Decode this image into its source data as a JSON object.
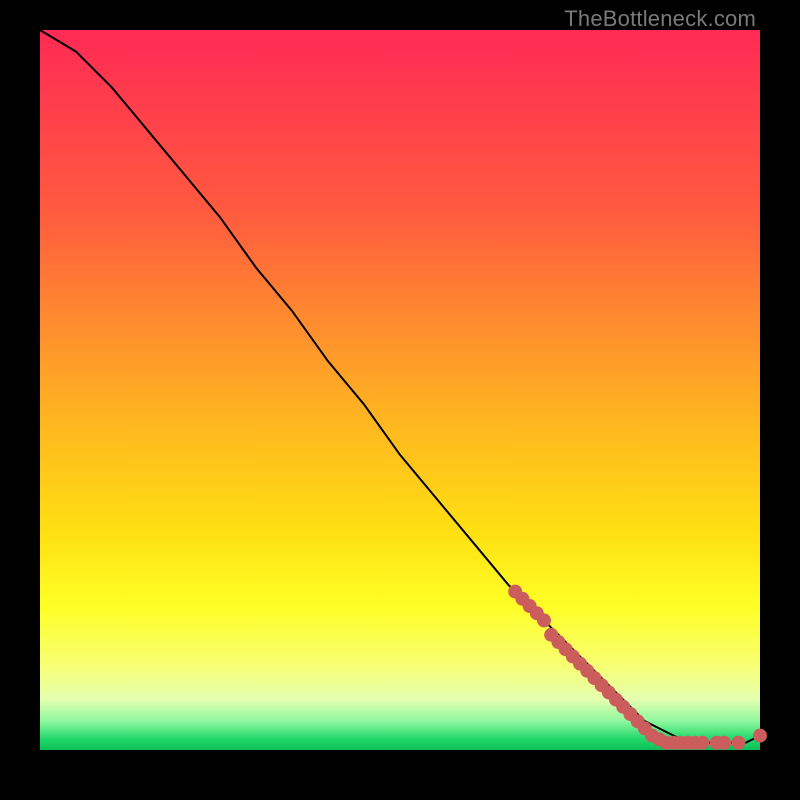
{
  "watermark": "TheBottleneck.com",
  "colors": {
    "marker": "#cc5d5d",
    "curve": "#000000"
  },
  "chart_data": {
    "type": "line",
    "title": "",
    "xlabel": "",
    "ylabel": "",
    "xlim": [
      0,
      100
    ],
    "ylim": [
      0,
      100
    ],
    "series": [
      {
        "name": "bottleneck-curve",
        "x": [
          0,
          5,
          10,
          15,
          20,
          25,
          30,
          35,
          40,
          45,
          50,
          55,
          60,
          65,
          70,
          75,
          80,
          82,
          84,
          86,
          88,
          90,
          92,
          94,
          96,
          98,
          100
        ],
        "y": [
          100,
          97,
          92,
          86,
          80,
          74,
          67,
          61,
          54,
          48,
          41,
          35,
          29,
          23,
          18,
          13,
          8,
          6,
          4,
          3,
          2,
          1,
          1,
          1,
          1,
          1,
          2
        ]
      }
    ],
    "markers": [
      {
        "x": 66,
        "y": 22
      },
      {
        "x": 67,
        "y": 21
      },
      {
        "x": 68,
        "y": 20
      },
      {
        "x": 69,
        "y": 19
      },
      {
        "x": 70,
        "y": 18
      },
      {
        "x": 71,
        "y": 16
      },
      {
        "x": 72,
        "y": 15
      },
      {
        "x": 73,
        "y": 14
      },
      {
        "x": 74,
        "y": 13
      },
      {
        "x": 75,
        "y": 12
      },
      {
        "x": 76,
        "y": 11
      },
      {
        "x": 77,
        "y": 10
      },
      {
        "x": 78,
        "y": 9
      },
      {
        "x": 79,
        "y": 8
      },
      {
        "x": 80,
        "y": 7
      },
      {
        "x": 81,
        "y": 6
      },
      {
        "x": 82,
        "y": 5
      },
      {
        "x": 83,
        "y": 4
      },
      {
        "x": 84,
        "y": 3
      },
      {
        "x": 85,
        "y": 2
      },
      {
        "x": 86,
        "y": 1.5
      },
      {
        "x": 87,
        "y": 1
      },
      {
        "x": 88,
        "y": 1
      },
      {
        "x": 89,
        "y": 1
      },
      {
        "x": 90,
        "y": 1
      },
      {
        "x": 91,
        "y": 1
      },
      {
        "x": 92,
        "y": 1
      },
      {
        "x": 94,
        "y": 1
      },
      {
        "x": 95,
        "y": 1
      },
      {
        "x": 97,
        "y": 1
      },
      {
        "x": 100,
        "y": 2
      }
    ]
  }
}
